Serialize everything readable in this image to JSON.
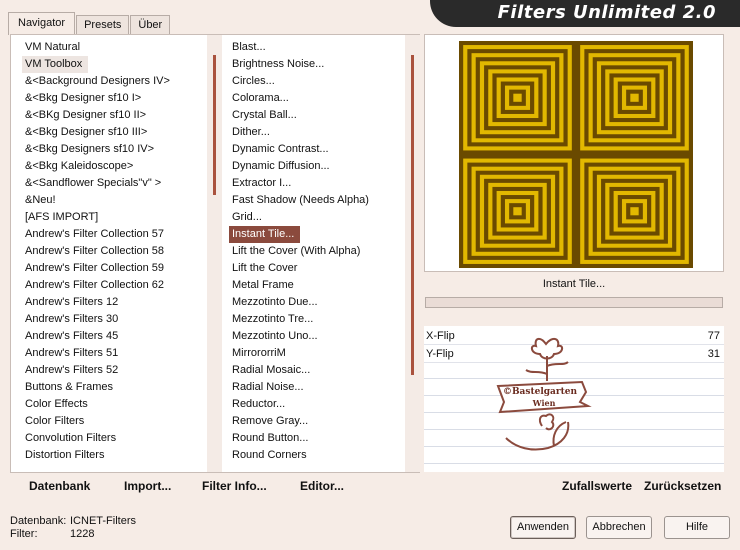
{
  "app": {
    "title": "Filters Unlimited 2.0"
  },
  "tabs": [
    {
      "label": "Navigator"
    },
    {
      "label": "Presets"
    },
    {
      "label": "Über"
    }
  ],
  "categories": [
    "VM Natural",
    "VM Toolbox",
    "&<Background Designers IV>",
    "&<Bkg Designer sf10 I>",
    "&<BKg Designer sf10 II>",
    "&<Bkg Designer sf10 III>",
    "&<Bkg Designers sf10 IV>",
    "&<Bkg Kaleidoscope>",
    "&<Sandflower Specials\"v\" >",
    "&Neu!",
    "[AFS IMPORT]",
    "Andrew's Filter Collection 57",
    "Andrew's Filter Collection 58",
    "Andrew's Filter Collection 59",
    "Andrew's Filter Collection 62",
    "Andrew's Filters 12",
    "Andrew's Filters 30",
    "Andrew's Filters 45",
    "Andrew's Filters 51",
    "Andrew's Filters 52",
    "Buttons & Frames",
    "Color Effects",
    "Color Filters",
    "Convolution Filters",
    "Distortion Filters"
  ],
  "filters": [
    "Blast...",
    "Brightness Noise...",
    "Circles...",
    "Colorama...",
    "Crystal Ball...",
    "Dither...",
    "Dynamic Contrast...",
    "Dynamic Diffusion...",
    "Extractor I...",
    "Fast Shadow (Needs Alpha)",
    "Grid...",
    "Instant Tile...",
    "Lift the Cover (With Alpha)",
    "Lift the Cover",
    "Metal Frame",
    "Mezzotinto Due...",
    "Mezzotinto Tre...",
    "Mezzotinto Uno...",
    "MirrororriM",
    "Radial Mosaic...",
    "Radial Noise...",
    "Reductor...",
    "Remove Gray...",
    "Round Button...",
    "Round Corners"
  ],
  "selected_category_index": 1,
  "selected_filter_index": 11,
  "bottom_links": {
    "database": "Datenbank",
    "import": "Import...",
    "filter_info": "Filter Info...",
    "editor": "Editor...",
    "random": "Zufallswerte",
    "reset": "Zurücksetzen"
  },
  "preview": {
    "filter_name": "Instant Tile..."
  },
  "params": [
    {
      "label": "X-Flip",
      "value": "77"
    },
    {
      "label": "Y-Flip",
      "value": "31"
    }
  ],
  "watermark": {
    "line1": "©Bastelgarten",
    "line2": "Wien"
  },
  "status": {
    "database_label": "Datenbank:",
    "database_value": "ICNET-Filters",
    "filter_label": "Filter:",
    "filter_value": "1228"
  },
  "buttons": {
    "apply": "Anwenden",
    "cancel": "Abbrechen",
    "help": "Hilfe"
  },
  "colors": {
    "selection": "#8b4a3d",
    "scroll_thumb": "#a9523e",
    "title_bg": "#2a2a2a",
    "tile_gold": "#e2b800",
    "tile_dark": "#6a4a00"
  }
}
